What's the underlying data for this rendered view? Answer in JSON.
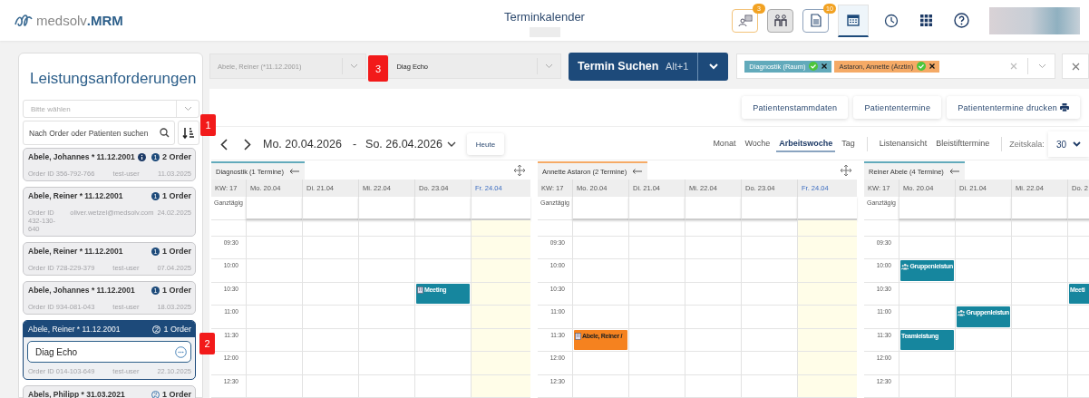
{
  "header": {
    "logo": {
      "prefix": "medsolv",
      "suffix": ".MRM"
    },
    "title": "Terminkalender",
    "icons": [
      {
        "kind": "cards",
        "badge": "3",
        "selected": false
      },
      {
        "kind": "people",
        "selected": false
      },
      {
        "kind": "document",
        "badge": "10",
        "selected": false
      },
      {
        "kind": "calendar",
        "selected": true
      },
      {
        "kind": "clock",
        "selected": false
      },
      {
        "kind": "grid",
        "selected": false
      },
      {
        "kind": "help",
        "selected": false
      }
    ]
  },
  "orders": {
    "title": "Leistungsanforderungen",
    "select_placeholder": "Bitte wählen",
    "search_placeholder": "Nach Order oder Patienten suchen",
    "cards": [
      {
        "patient": "Abele, Johannes * 11.12.2001",
        "info": true,
        "badge": {
          "text": "1",
          "filled": true
        },
        "count": "2 Order",
        "order_id": "Order ID 356-792-766",
        "user": "test-user",
        "date": "11.03.2025",
        "selected": false
      },
      {
        "patient": "Abele, Reiner * 11.12.2001",
        "info": false,
        "badge": {
          "text": "1",
          "filled": true
        },
        "count": "1 Order",
        "order_id": "Order ID 432-130-640",
        "user": "oliver.wetzel@medsolv.com",
        "date": "24.02.2025",
        "selected": false
      },
      {
        "patient": "Abele, Reiner * 11.12.2001",
        "info": false,
        "badge": {
          "text": "1",
          "filled": true
        },
        "count": "1 Order",
        "order_id": "Order ID 728-229-379",
        "user": "test-user",
        "date": "07.04.2025",
        "selected": false
      },
      {
        "patient": "Abele, Johannes * 11.12.2001",
        "info": false,
        "badge": {
          "text": "1",
          "filled": true
        },
        "count": "1 Order",
        "order_id": "Order ID 934-081-043",
        "user": "test-user",
        "date": "18.03.2025",
        "selected": false
      },
      {
        "patient": "Abele, Reiner * 11.12.2001",
        "info": false,
        "badge": {
          "text": "2",
          "filled": false
        },
        "count": "1 Order",
        "items": [
          "Diag Echo"
        ],
        "order_id": "Order ID 014-103-649",
        "user": "test-user",
        "date": "22.10.2025",
        "selected": true
      },
      {
        "patient": "Abels, Philipp * 31.03.2021",
        "info": false,
        "badge": {
          "text": "2",
          "filled": false
        },
        "count": "1 Order",
        "selected": false
      }
    ]
  },
  "toolbar": {
    "patient_select": {
      "value": "Abele, Reiner (*11.12.2001)",
      "disabled": true
    },
    "order_select": {
      "value": "Diag Echo",
      "disabled": false
    },
    "search_button": {
      "label": "Termin Suchen",
      "shortcut": "Alt+1"
    },
    "filters": [
      {
        "text": "Diagnostik (Raum)",
        "color": "#62aabb"
      },
      {
        "text": "Astaron, Annette (Ärztin)",
        "color": "#f5aa66"
      }
    ]
  },
  "actions": [
    {
      "label": "Patientenstammdaten",
      "printer": false
    },
    {
      "label": "Patiententermine",
      "printer": false
    },
    {
      "label": "Patiententermine drucken",
      "printer": true
    }
  ],
  "nav": {
    "from": "Mo. 20.04.2026",
    "separator": "-",
    "to": "So. 26.04.2026",
    "today_button": "Heute",
    "views": [
      {
        "label": "Monat",
        "selected": false
      },
      {
        "label": "Woche",
        "selected": false
      },
      {
        "label": "Arbeitswoche",
        "selected": true
      },
      {
        "label": "Tag",
        "selected": false
      }
    ],
    "modes": [
      "Listenansicht",
      "Bleistifttermine"
    ],
    "scale": {
      "label": "Zeitskala:",
      "value": "30"
    }
  },
  "calendar": {
    "panels": [
      {
        "title": "Diagnostik (1 Termine)",
        "color": "#62aabb",
        "expand_icon": true,
        "week": "KW: 17",
        "all_day": "Ganztägig",
        "days": [
          {
            "label": "Mo. 20.04",
            "today": false
          },
          {
            "label": "Di. 21.04",
            "today": false
          },
          {
            "label": "Mi. 22.04",
            "today": false
          },
          {
            "label": "Do. 23.04",
            "today": false
          },
          {
            "label": "Fr. 24.04",
            "today": true
          }
        ],
        "rows": [
          {
            "time": "09:30",
            "cells": [
              {
                "today": false
              },
              {
                "today": false
              },
              {
                "today": false
              },
              {
                "today": false
              },
              {
                "today": true
              }
            ]
          },
          {
            "time": "10:00",
            "cells": [
              {
                "today": false
              },
              {
                "today": false
              },
              {
                "today": false
              },
              {
                "today": false
              },
              {
                "today": true
              }
            ]
          },
          {
            "time": "10:30",
            "cells": [
              {
                "today": false
              },
              {
                "today": false
              },
              {
                "today": false
              },
              {
                "today": false,
                "appointments": [
                  {
                    "text": "Meeting",
                    "kind": "meeting",
                    "color": "#16869e"
                  }
                ]
              },
              {
                "today": true
              }
            ]
          },
          {
            "time": "11:00",
            "cells": [
              {
                "today": false
              },
              {
                "today": false
              },
              {
                "today": false
              },
              {
                "today": false
              },
              {
                "today": true
              }
            ]
          },
          {
            "time": "11:30",
            "cells": [
              {
                "today": false
              },
              {
                "today": false
              },
              {
                "today": false
              },
              {
                "today": false
              },
              {
                "today": true
              }
            ]
          },
          {
            "time": "12:00",
            "cells": [
              {
                "today": false
              },
              {
                "today": false
              },
              {
                "today": false
              },
              {
                "today": false
              },
              {
                "today": true
              }
            ]
          },
          {
            "time": "12:30",
            "cells": [
              {
                "today": false
              },
              {
                "today": false
              },
              {
                "today": false
              },
              {
                "today": false
              },
              {
                "today": true
              }
            ]
          }
        ]
      },
      {
        "title": "Annette Astaron (2 Termine)",
        "color": "#f5aa66",
        "expand_icon": true,
        "week": "KW: 17",
        "all_day": "Ganztägig",
        "days": [
          {
            "label": "Mo. 20.04",
            "today": false
          },
          {
            "label": "Di. 21.04",
            "today": false
          },
          {
            "label": "Mi. 22.04",
            "today": false
          },
          {
            "label": "Do. 23.04",
            "today": false
          },
          {
            "label": "Fr. 24.04",
            "today": true
          }
        ],
        "rows": [
          {
            "time": "09:30",
            "cells": [
              {
                "today": false
              },
              {
                "today": false
              },
              {
                "today": false
              },
              {
                "today": false
              },
              {
                "today": true
              }
            ]
          },
          {
            "time": "10:00",
            "cells": [
              {
                "today": false
              },
              {
                "today": false
              },
              {
                "today": false
              },
              {
                "today": false
              },
              {
                "today": true
              }
            ]
          },
          {
            "time": "10:30",
            "cells": [
              {
                "today": false
              },
              {
                "today": false
              },
              {
                "today": false
              },
              {
                "today": false
              },
              {
                "today": true
              }
            ]
          },
          {
            "time": "11:00",
            "cells": [
              {
                "today": false
              },
              {
                "today": false
              },
              {
                "today": false
              },
              {
                "today": false
              },
              {
                "today": true
              }
            ]
          },
          {
            "time": "11:30",
            "cells": [
              {
                "today": false,
                "appointments": [
                  {
                    "text": "Abele, Reiner /",
                    "kind": "meeting",
                    "color": "#f5821f"
                  }
                ]
              },
              {
                "today": false
              },
              {
                "today": false
              },
              {
                "today": false
              },
              {
                "today": true
              }
            ]
          },
          {
            "time": "12:00",
            "cells": [
              {
                "today": false
              },
              {
                "today": false
              },
              {
                "today": false
              },
              {
                "today": false
              },
              {
                "today": true
              }
            ]
          },
          {
            "time": "12:30",
            "cells": [
              {
                "today": false
              },
              {
                "today": false
              },
              {
                "today": false
              },
              {
                "today": false
              },
              {
                "today": true
              }
            ]
          }
        ]
      },
      {
        "title": "Reiner Abele (4 Termine)",
        "color": "#62aabb",
        "expand_icon": false,
        "week": "KW: 17",
        "all_day": "Ganztägig",
        "days": [
          {
            "label": "Mo. 20.04",
            "today": false
          },
          {
            "label": "Di. 21.04",
            "today": false
          },
          {
            "label": "Mi. 22.04",
            "today": false
          },
          {
            "label": "Do. 2",
            "today": false
          }
        ],
        "rows": [
          {
            "time": "09:30",
            "cells": [
              {
                "today": false
              },
              {
                "today": false
              },
              {
                "today": false
              },
              {
                "today": false
              }
            ]
          },
          {
            "time": "10:00",
            "cells": [
              {
                "today": false,
                "appointments": [
                  {
                    "text": "Gruppenleistun",
                    "kind": "group",
                    "color": "#16869e"
                  }
                ]
              },
              {
                "today": false
              },
              {
                "today": false
              },
              {
                "today": false
              }
            ]
          },
          {
            "time": "10:30",
            "cells": [
              {
                "today": false
              },
              {
                "today": false
              },
              {
                "today": false
              },
              {
                "today": false,
                "appointments": [
                  {
                    "text": "Meeti",
                    "kind": "plain",
                    "color": "#16869e"
                  }
                ]
              }
            ]
          },
          {
            "time": "11:00",
            "cells": [
              {
                "today": false
              },
              {
                "today": false,
                "appointments": [
                  {
                    "text": "Gruppenleistun",
                    "kind": "group",
                    "color": "#16869e"
                  }
                ]
              },
              {
                "today": false
              },
              {
                "today": false
              }
            ]
          },
          {
            "time": "11:30",
            "cells": [
              {
                "today": false,
                "appointments": [
                  {
                    "text": "Teamleistung",
                    "kind": "plain",
                    "color": "#16869e"
                  }
                ]
              },
              {
                "today": false
              },
              {
                "today": false
              },
              {
                "today": false
              }
            ]
          },
          {
            "time": "12:00",
            "cells": [
              {
                "today": false
              },
              {
                "today": false
              },
              {
                "today": false
              },
              {
                "today": false
              }
            ]
          },
          {
            "time": "12:30",
            "cells": [
              {
                "today": false
              },
              {
                "today": false
              },
              {
                "today": false
              },
              {
                "today": false
              }
            ]
          }
        ]
      }
    ]
  },
  "markers": [
    "1",
    "2",
    "3"
  ]
}
